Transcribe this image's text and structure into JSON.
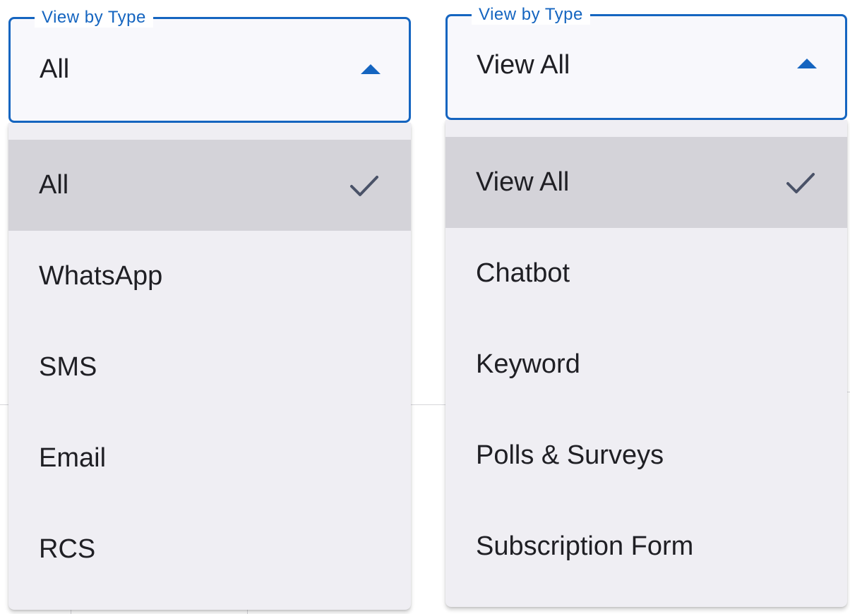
{
  "left_dropdown": {
    "label": "View by Type",
    "selected_value": "All",
    "options": [
      {
        "label": "All",
        "selected": true
      },
      {
        "label": "WhatsApp",
        "selected": false
      },
      {
        "label": "SMS",
        "selected": false
      },
      {
        "label": "Email",
        "selected": false
      },
      {
        "label": "RCS",
        "selected": false
      }
    ]
  },
  "right_dropdown": {
    "label": "View by Type",
    "selected_value": "View All",
    "options": [
      {
        "label": "View All",
        "selected": true
      },
      {
        "label": "Chatbot",
        "selected": false
      },
      {
        "label": "Keyword",
        "selected": false
      },
      {
        "label": "Polls & Surveys",
        "selected": false
      },
      {
        "label": "Subscription Form",
        "selected": false
      }
    ]
  },
  "colors": {
    "accent": "#1565c0",
    "menu_background": "#efeef3",
    "selected_background": "#d4d3d9",
    "text": "#1f1f24",
    "check": "#4a5268"
  },
  "icons": {
    "open_indicator": "arrow-up-icon",
    "selected_indicator": "check-icon"
  }
}
